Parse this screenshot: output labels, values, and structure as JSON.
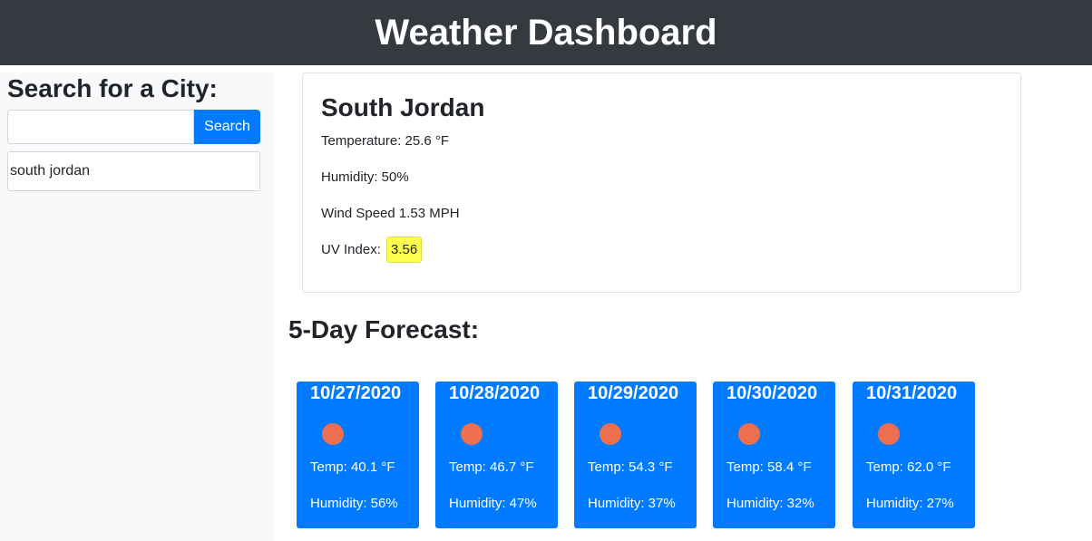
{
  "header": {
    "title": "Weather Dashboard"
  },
  "sidebar": {
    "heading": "Search for a City:",
    "search_value": "",
    "search_button": "Search",
    "history": [
      "south jordan"
    ]
  },
  "current": {
    "city": "South Jordan",
    "temperature": "Temperature: 25.6 °F",
    "humidity": "Humidity: 50%",
    "wind": "Wind Speed 1.53 MPH",
    "uv_label": "UV Index:",
    "uv_value": "3.56",
    "uv_color": "#ffff4d"
  },
  "forecast": {
    "title": "5-Day Forecast:",
    "days": [
      {
        "date": "10/27/2020",
        "icon": "sun-icon",
        "temp": "Temp: 40.1 °F",
        "humidity": "Humidity: 56%"
      },
      {
        "date": "10/28/2020",
        "icon": "sun-icon",
        "temp": "Temp: 46.7 °F",
        "humidity": "Humidity: 47%"
      },
      {
        "date": "10/29/2020",
        "icon": "sun-icon",
        "temp": "Temp: 54.3 °F",
        "humidity": "Humidity: 37%"
      },
      {
        "date": "10/30/2020",
        "icon": "sun-icon",
        "temp": "Temp: 58.4 °F",
        "humidity": "Humidity: 32%"
      },
      {
        "date": "10/31/2020",
        "icon": "sun-icon",
        "temp": "Temp: 62.0 °F",
        "humidity": "Humidity: 27%"
      }
    ]
  },
  "colors": {
    "header_bg": "#343a40",
    "accent": "#007bff",
    "sidebar_bg": "#f8f9fa",
    "icon_sun": "#ee6e50"
  }
}
